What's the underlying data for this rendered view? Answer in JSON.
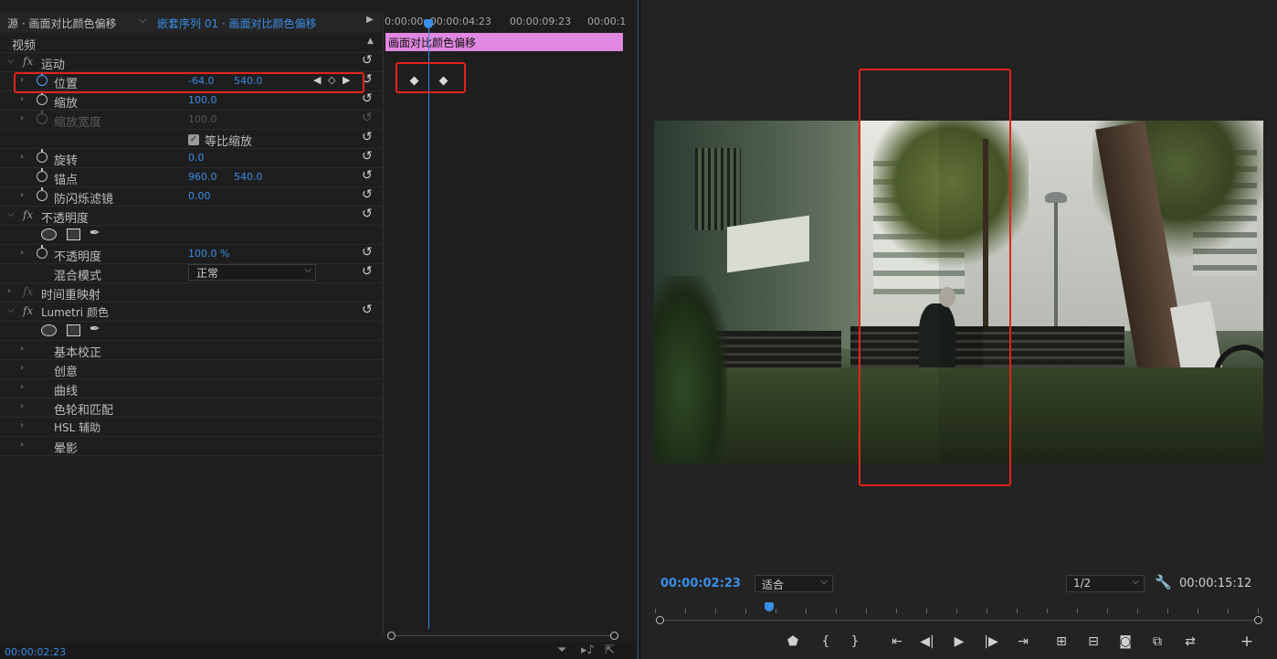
{
  "source_tab": "源 · 画面对比颜色偏移",
  "sequence_tab": "嵌套序列 01 · 画面对比颜色偏移",
  "timeline_ruler": [
    "0:00:00",
    ":00:00:04:23",
    "00:00:09:23",
    "00:00:1"
  ],
  "clip_name": "画面对比颜色偏移",
  "effects": {
    "video_header": "视频",
    "motion": {
      "name": "运动",
      "position": {
        "label": "位置",
        "x": "-64.0",
        "y": "540.0"
      },
      "scale": {
        "label": "缩放",
        "value": "100.0"
      },
      "scale_width": {
        "label": "缩放宽度",
        "value": "100.0"
      },
      "uniform_scale": {
        "label": "等比缩放",
        "checked": true
      },
      "rotation": {
        "label": "旋转",
        "value": "0.0"
      },
      "anchor": {
        "label": "锚点",
        "x": "960.0",
        "y": "540.0"
      },
      "anti_flicker": {
        "label": "防闪烁滤镜",
        "value": "0.00"
      }
    },
    "opacity": {
      "name": "不透明度",
      "opacity": {
        "label": "不透明度",
        "value": "100.0 %"
      },
      "blend_mode": {
        "label": "混合模式",
        "value": "正常"
      }
    },
    "time_remap": {
      "name": "时间重映射"
    },
    "lumetri": {
      "name": "Lumetri 颜色",
      "sections": [
        "基本校正",
        "创意",
        "曲线",
        "色轮和匹配",
        "HSL 辅助",
        "晕影"
      ]
    }
  },
  "bottom_timecode": "00:00:02:23",
  "monitor": {
    "current_timecode": "00:00:02:23",
    "zoom": "适合",
    "resolution": "1/2",
    "duration": "00:00:15:12"
  },
  "icons": {
    "reset": "reset-icon",
    "stopwatch": "stopwatch-icon",
    "keyframe": "keyframe-diamond-icon",
    "pen": "pen-mask-icon",
    "wrench": "wrench-icon"
  },
  "colors": {
    "accent": "#3a8ee6",
    "clip": "#e087e0",
    "highlight": "#e0241b"
  }
}
